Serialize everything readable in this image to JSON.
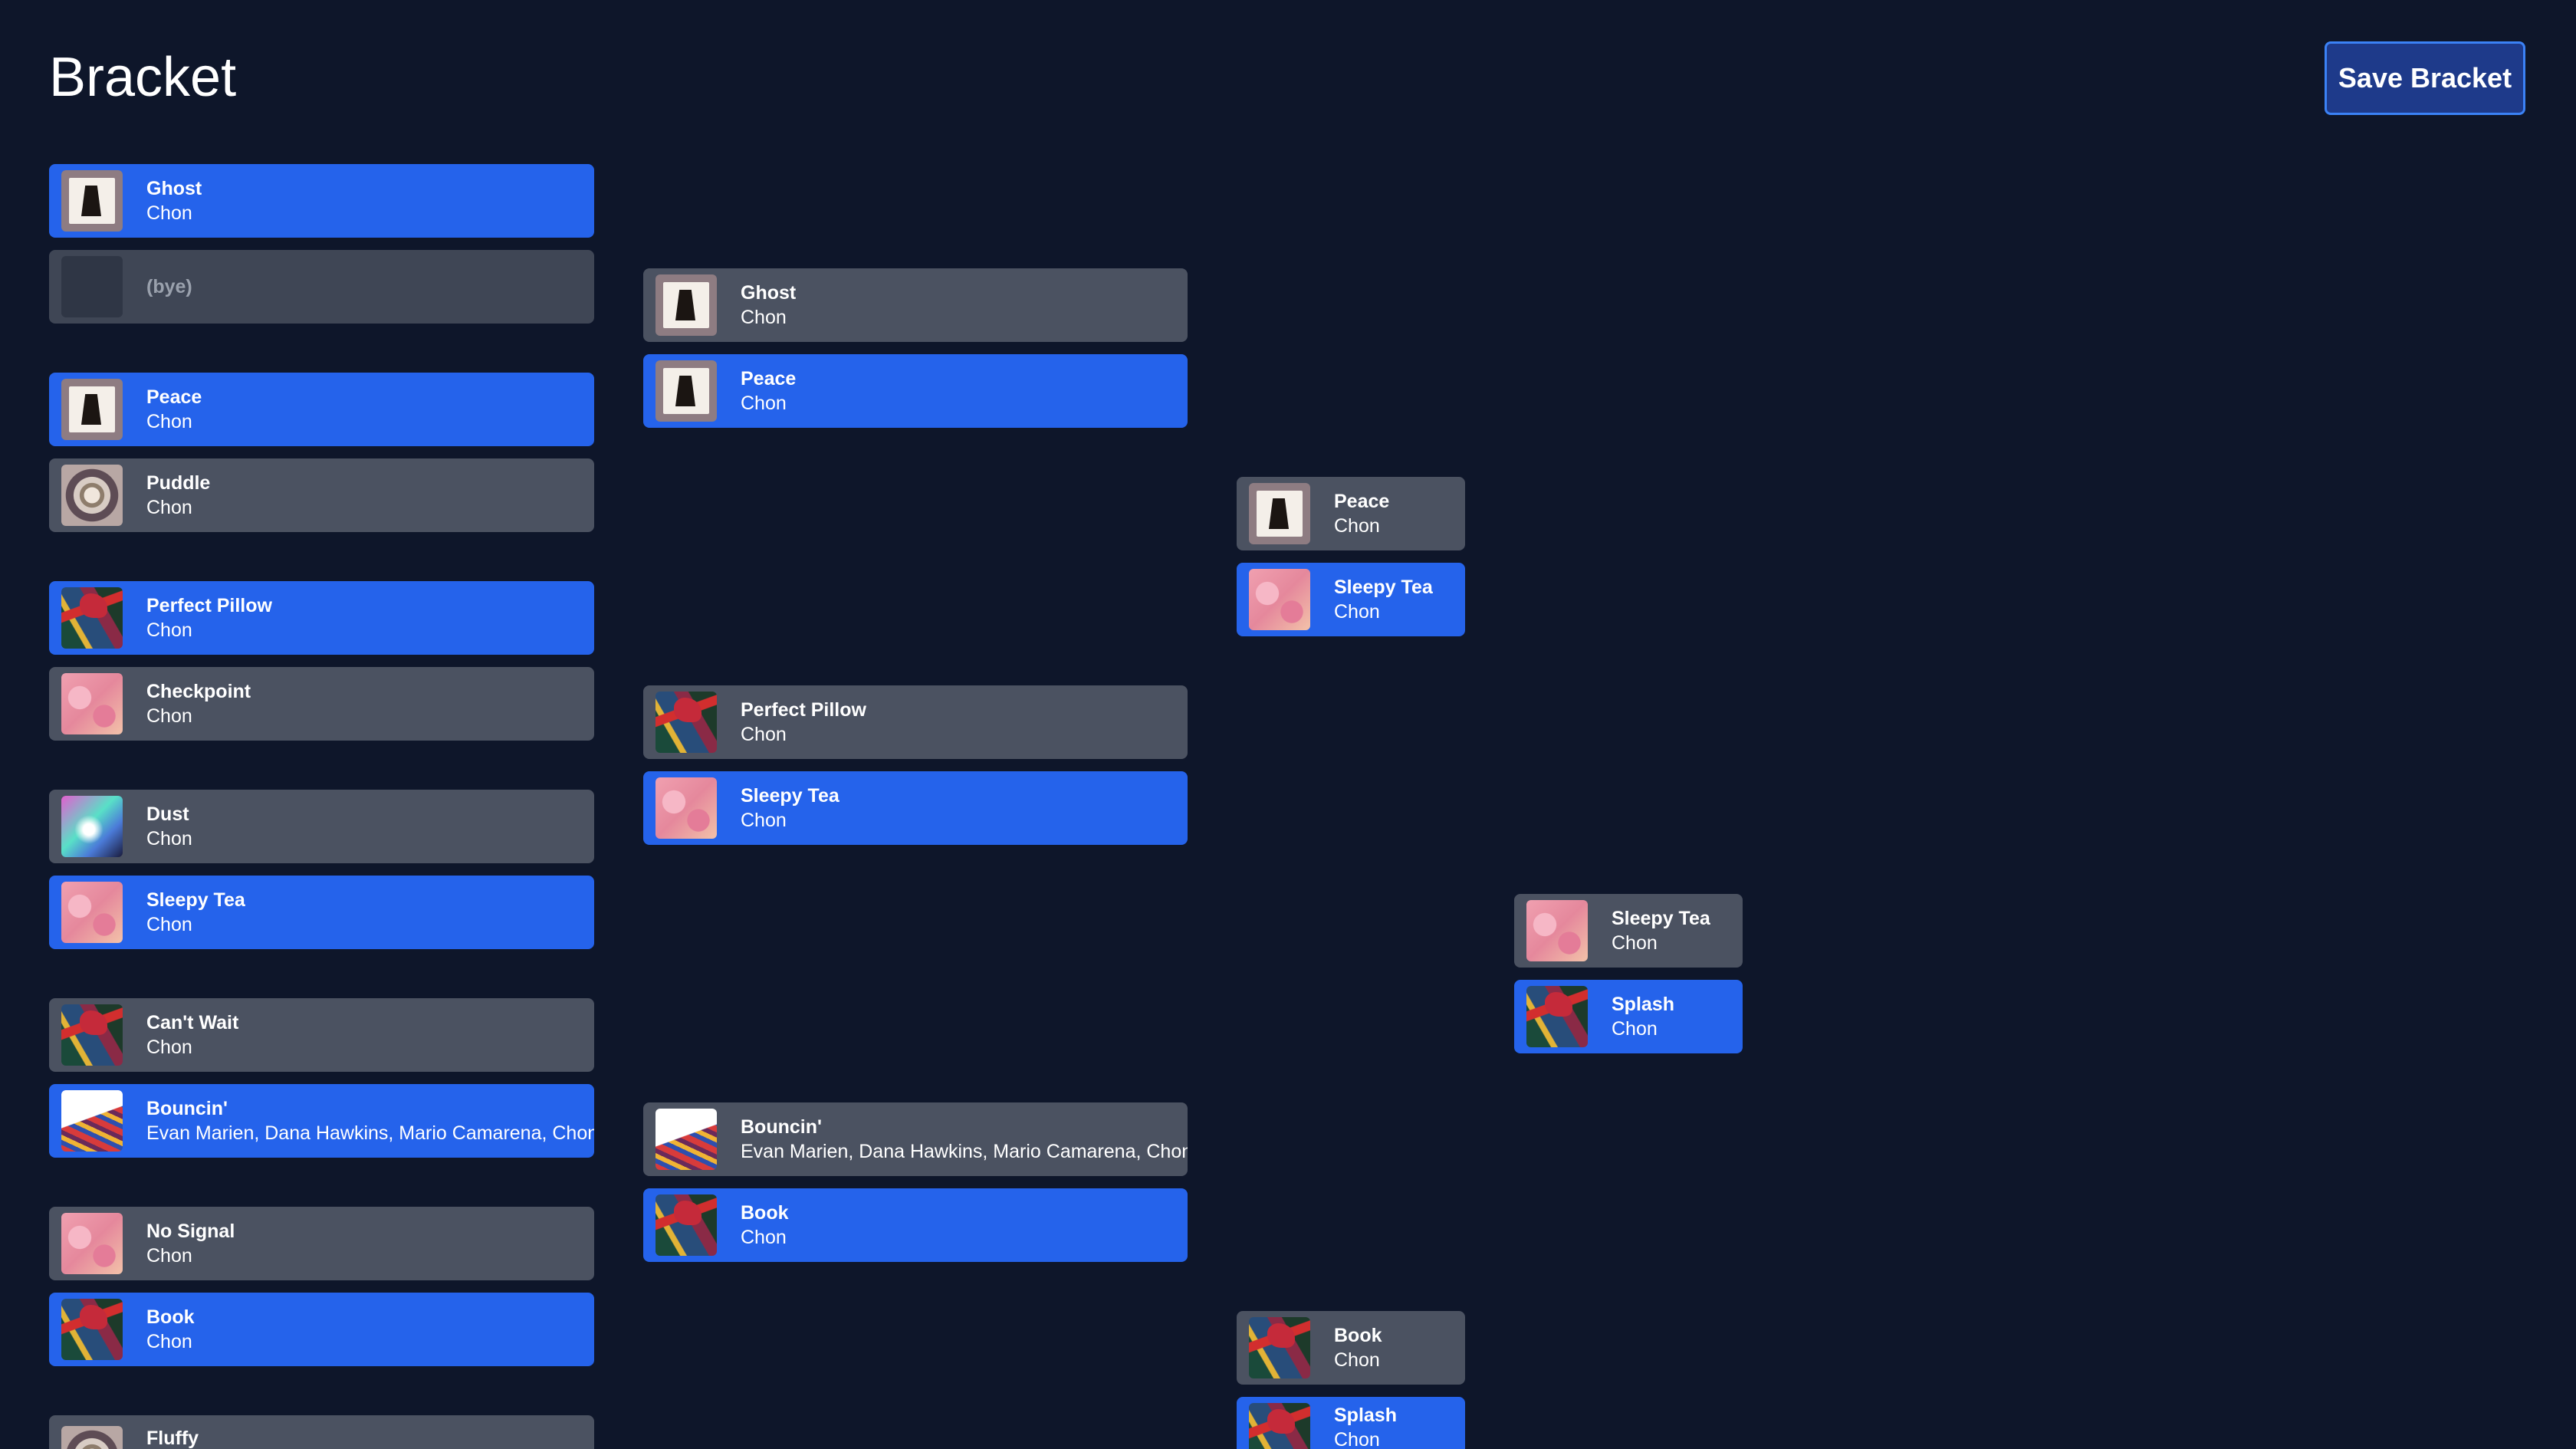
{
  "header": {
    "title": "Bracket",
    "save_label": "Save Bracket"
  },
  "bye_label": "(bye)",
  "round1": [
    {
      "song": "Ghost",
      "artist": "Chon",
      "art": "ghost-album-art",
      "status": "winner"
    },
    {
      "song": "",
      "artist": "",
      "art": "empty",
      "status": "bye"
    },
    {
      "song": "Peace",
      "artist": "Chon",
      "art": "ghost-album-art",
      "status": "winner"
    },
    {
      "song": "Puddle",
      "artist": "Chon",
      "art": "puddle-album-art",
      "status": "loser"
    },
    {
      "song": "Perfect Pillow",
      "artist": "Chon",
      "art": "colorful-album-art",
      "status": "winner"
    },
    {
      "song": "Checkpoint",
      "artist": "Chon",
      "art": "pink-album-art",
      "status": "loser"
    },
    {
      "song": "Dust",
      "artist": "Chon",
      "art": "dust-album-art",
      "status": "loser"
    },
    {
      "song": "Sleepy Tea",
      "artist": "Chon",
      "art": "pink-album-art",
      "status": "winner"
    },
    {
      "song": "Can't Wait",
      "artist": "Chon",
      "art": "colorful-album-art",
      "status": "loser"
    },
    {
      "song": "Bouncin'",
      "artist": "Evan Marien, Dana Hawkins, Mario Camarena, Chon",
      "art": "bouncin-album-art",
      "status": "winner"
    },
    {
      "song": "No Signal",
      "artist": "Chon",
      "art": "pink-album-art",
      "status": "loser"
    },
    {
      "song": "Book",
      "artist": "Chon",
      "art": "colorful-album-art",
      "status": "winner"
    },
    {
      "song": "Fluffy",
      "artist": "",
      "art": "puddle-album-art",
      "status": "loser"
    }
  ],
  "round2": [
    {
      "song": "Ghost",
      "artist": "Chon",
      "art": "ghost-album-art",
      "status": "loser"
    },
    {
      "song": "Peace",
      "artist": "Chon",
      "art": "ghost-album-art",
      "status": "winner"
    },
    {
      "song": "Perfect Pillow",
      "artist": "Chon",
      "art": "colorful-album-art",
      "status": "loser"
    },
    {
      "song": "Sleepy Tea",
      "artist": "Chon",
      "art": "pink-album-art",
      "status": "winner"
    },
    {
      "song": "Bouncin'",
      "artist": "Evan Marien, Dana Hawkins, Mario Camarena, Chon",
      "art": "bouncin-album-art",
      "status": "loser"
    },
    {
      "song": "Book",
      "artist": "Chon",
      "art": "colorful-album-art",
      "status": "winner"
    }
  ],
  "round3": [
    {
      "song": "Peace",
      "artist": "Chon",
      "art": "ghost-album-art",
      "status": "loser"
    },
    {
      "song": "Sleepy Tea",
      "artist": "Chon",
      "art": "pink-album-art",
      "status": "winner"
    },
    {
      "song": "Book",
      "artist": "Chon",
      "art": "colorful-album-art",
      "status": "loser"
    },
    {
      "song": "Splash",
      "artist": "Chon",
      "art": "colorful-album-art",
      "status": "winner"
    }
  ],
  "round4": [
    {
      "song": "Sleepy Tea",
      "artist": "Chon",
      "art": "pink-album-art",
      "status": "loser"
    },
    {
      "song": "Splash",
      "artist": "Chon",
      "art": "colorful-album-art",
      "status": "winner"
    }
  ],
  "colors": {
    "background": "#0e162a",
    "winner": "#2563eb",
    "loser": "#4b5261",
    "save_button": "#1e3a8a"
  }
}
